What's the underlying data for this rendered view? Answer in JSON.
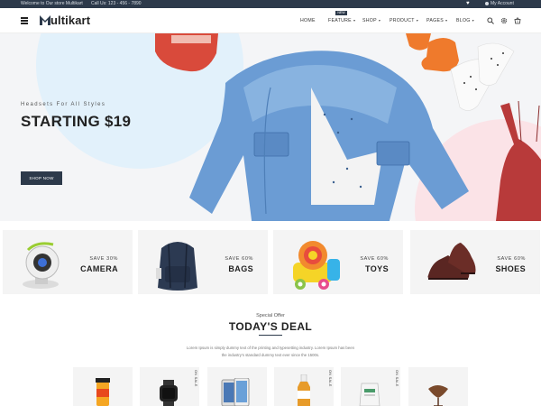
{
  "topbar": {
    "welcome": "Welcome to Our store Multikart",
    "call": "Call Us: 123 - 456 - 7890",
    "account": "My Account"
  },
  "header": {
    "logo_text": "ultikart",
    "nav": [
      {
        "label": "HOME"
      },
      {
        "label": "FEATURE",
        "badge": "NEW"
      },
      {
        "label": "SHOP"
      },
      {
        "label": "PRODUCT"
      },
      {
        "label": "PAGES"
      },
      {
        "label": "BLOG"
      }
    ],
    "icons": [
      "search-icon",
      "gear-icon",
      "cart-icon"
    ]
  },
  "hero": {
    "kicker": "Headsets For All Styles",
    "title": "STARTING $19",
    "button": "SHOP NOW"
  },
  "categories": [
    {
      "save": "SAVE 30%",
      "name": "CAMERA"
    },
    {
      "save": "SAVE 60%",
      "name": "BAGS"
    },
    {
      "save": "SAVE 60%",
      "name": "TOYS"
    },
    {
      "save": "SAVE 60%",
      "name": "SHOES"
    }
  ],
  "deal": {
    "kicker": "Special Offer",
    "title": "TODAY'S DEAL",
    "description_line1": "Lorem Ipsum is simply dummy text of the printing and typesetting industry. Lorem Ipsum has been",
    "description_line2": "the industry's standard dummy text ever since the 1500s."
  },
  "products": [
    {
      "name": "juice"
    },
    {
      "name": "watch",
      "tag": "ON SALE"
    },
    {
      "name": "phone"
    },
    {
      "name": "bottle",
      "tag": "ON SALE"
    },
    {
      "name": "powder",
      "tag": "ON SALE"
    },
    {
      "name": "chair"
    }
  ],
  "colors": {
    "navy": "#2d3a4b",
    "hero_bg": "#f4f5f7",
    "blue_circle": "#e2f1fb",
    "pink_circle": "#fbe3e7"
  }
}
